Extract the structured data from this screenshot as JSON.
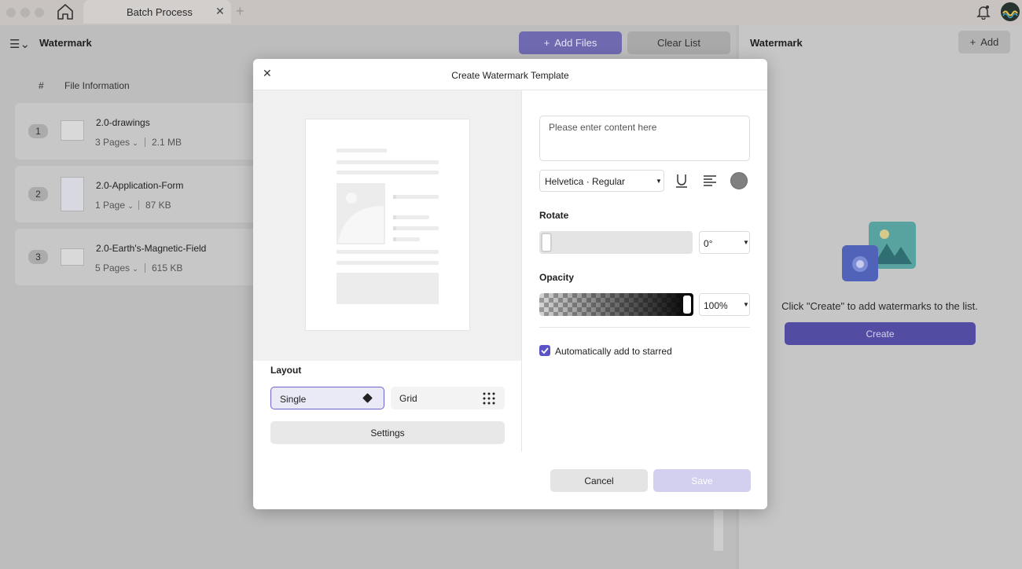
{
  "titlebar": {
    "tab_title": "Batch Process",
    "tab_close": "✕",
    "tab_add": "+"
  },
  "main": {
    "title": "Watermark",
    "add_files_label": "Add Files",
    "clear_list_label": "Clear List",
    "columns": {
      "number": "#",
      "info": "File Information"
    },
    "files": [
      {
        "num": "1",
        "name": "2.0-drawings",
        "pages": "3 Pages",
        "size": "2.1 MB"
      },
      {
        "num": "2",
        "name": "2.0-Application-Form",
        "pages": "1 Page",
        "size": "87 KB"
      },
      {
        "num": "3",
        "name": "2.0-Earth's-Magnetic-Field",
        "pages": "5 Pages",
        "size": "615 KB"
      }
    ]
  },
  "right_panel": {
    "title": "Watermark",
    "add_label": "Add",
    "hint": "Click \"Create\" to add watermarks to the list.",
    "create_label": "Create"
  },
  "modal": {
    "title": "Create Watermark Template",
    "close": "✕",
    "content_placeholder": "Please enter content here",
    "font": "Helvetica · Regular",
    "rotate_label": "Rotate",
    "rotate_value": "0°",
    "opacity_label": "Opacity",
    "opacity_value": "100%",
    "opacity_level": 1.0,
    "auto_starred_label": "Automatically add to starred",
    "auto_starred_checked": true,
    "layout_label": "Layout",
    "layout_single": "Single",
    "layout_grid": "Grid",
    "settings_label": "Settings",
    "cancel_label": "Cancel",
    "save_label": "Save",
    "watermark_color": "#808080",
    "accent_color": "#5a54c8"
  }
}
